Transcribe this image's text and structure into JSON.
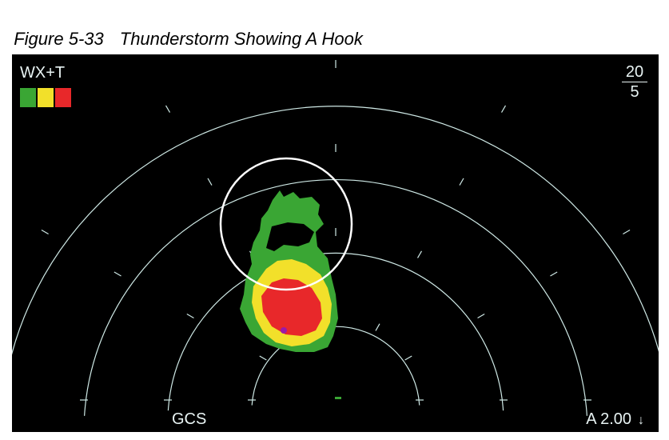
{
  "caption": {
    "number": "Figure 5-33",
    "title": "Thunderstorm Showing A Hook"
  },
  "display": {
    "mode": "WX+T",
    "legend_colors": [
      "#3aa634",
      "#f2e02a",
      "#e8282a"
    ],
    "range_top": "20",
    "range_bottom": "5",
    "bottom_left_label": "GCS",
    "tilt_value": "A 2.00",
    "tilt_arrow": "↓",
    "ring_color": "#cfe9e6",
    "highlight_circle_color": "#ffffff"
  }
}
